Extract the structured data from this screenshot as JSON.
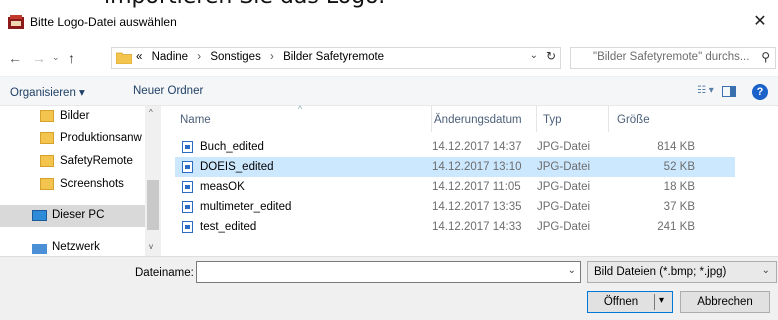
{
  "background_caption": "importieren Sie das Logo.",
  "window": {
    "title": "Bitte Logo-Datei auswählen",
    "close_glyph": "✕"
  },
  "address": {
    "back_glyph": "←",
    "forward_glyph": "→",
    "recent_glyph": "⌄",
    "up_glyph": "↑",
    "overflow": "«",
    "crumbs": [
      "Nadine",
      "Sonstiges",
      "Bilder Safetyremote"
    ],
    "separator": "›",
    "dropdown_glyph": "⌄",
    "refresh_glyph": "↻"
  },
  "search": {
    "placeholder": "\"Bilder Safetyremote\" durchs...",
    "icon_glyph": "⚲"
  },
  "toolbar": {
    "organize_label": "Organisieren ▾",
    "new_folder_label": "Neuer Ordner",
    "view_glyph": "☷ ▾",
    "help_glyph": "?"
  },
  "sidebar": {
    "items": [
      {
        "label": "Bilder",
        "kind": "folder"
      },
      {
        "label": "Produktionsanw",
        "kind": "folder"
      },
      {
        "label": "SafetyRemote",
        "kind": "folder"
      },
      {
        "label": "Screenshots",
        "kind": "folder"
      },
      {
        "label": "Dieser PC",
        "kind": "pc",
        "selected": true
      },
      {
        "label": "Netzwerk",
        "kind": "network"
      }
    ],
    "scroll_up_glyph": "^",
    "scroll_down_glyph": "v"
  },
  "columns": {
    "name": "Name",
    "date": "Änderungsdatum",
    "type": "Typ",
    "size": "Größe",
    "sort_glyph": "^"
  },
  "files": [
    {
      "name": "Buch_edited",
      "date": "14.12.2017 14:37",
      "type": "JPG-Datei",
      "size": "814 KB",
      "selected": false
    },
    {
      "name": "DOEIS_edited",
      "date": "14.12.2017 13:10",
      "type": "JPG-Datei",
      "size": "52 KB",
      "selected": true
    },
    {
      "name": "measOK",
      "date": "14.12.2017 11:05",
      "type": "JPG-Datei",
      "size": "18 KB",
      "selected": false
    },
    {
      "name": "multimeter_edited",
      "date": "14.12.2017 13:35",
      "type": "JPG-Datei",
      "size": "37 KB",
      "selected": false
    },
    {
      "name": "test_edited",
      "date": "14.12.2017 14:33",
      "type": "JPG-Datei",
      "size": "241 KB",
      "selected": false
    }
  ],
  "footer": {
    "filename_label": "Dateiname:",
    "filename_value": "",
    "dropdown_glyph": "⌄",
    "filetype_value": "Bild Dateien (*.bmp; *.jpg)",
    "open_label": "Öffnen",
    "open_dropdown_glyph": "▾",
    "cancel_label": "Abbrechen"
  },
  "colors": {
    "accent": "#0078d7",
    "selection": "#cce8ff",
    "folder": "#f3c44e"
  }
}
